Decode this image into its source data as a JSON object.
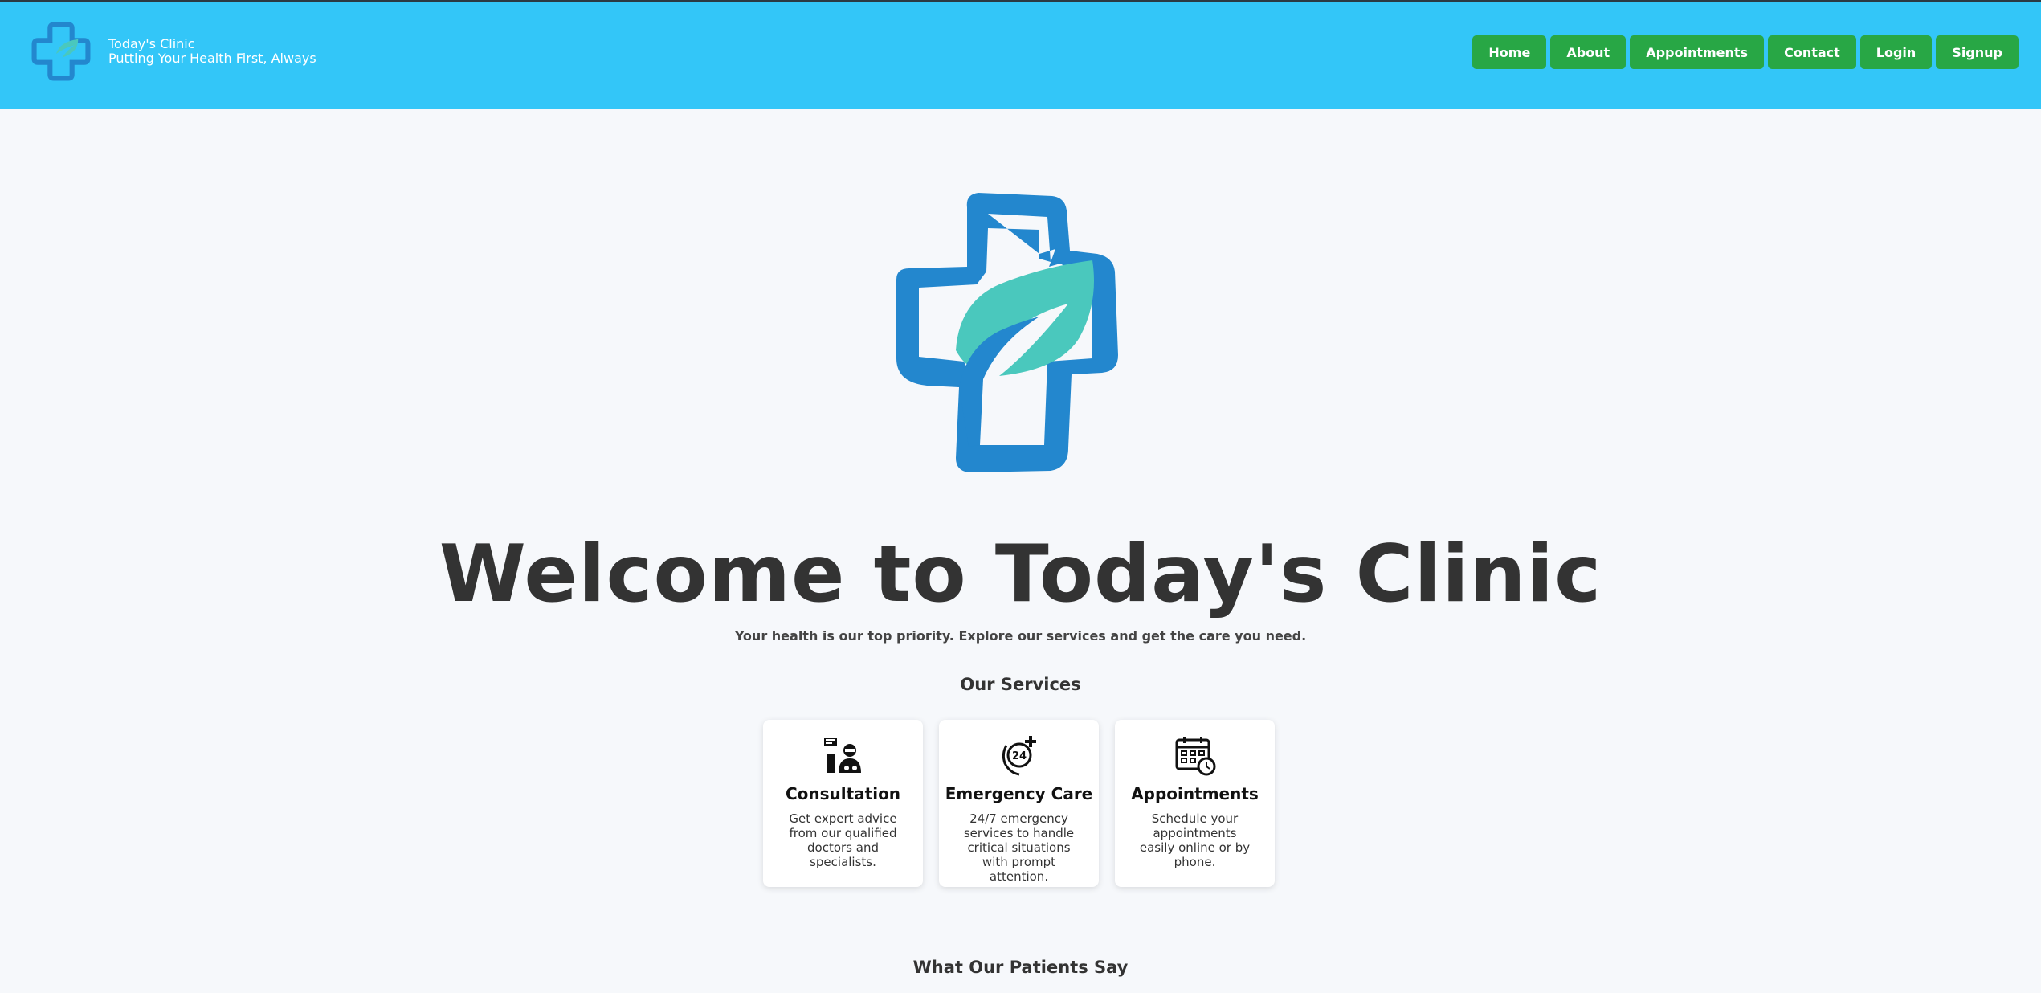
{
  "header": {
    "brand_name": "Today's Clinic",
    "tagline": "Putting Your Health First, Always",
    "logo_icon": "medical-cross-leaf-icon",
    "bg_color": "#33c6f8"
  },
  "nav": {
    "items": [
      "Home",
      "About",
      "Appointments",
      "Contact",
      "Login",
      "Signup"
    ],
    "button_color": "#28a745"
  },
  "hero": {
    "logo_icon": "medical-cross-leaf-icon",
    "title": "Welcome to Today's Clinic",
    "subtitle": "Your health is our top priority. Explore our services and get the care you need."
  },
  "services": {
    "title": "Our Services",
    "cards": [
      {
        "icon": "doctor-consultation-icon",
        "title": "Consultation",
        "description": "Get expert advice from our qualified doctors and specialists."
      },
      {
        "icon": "emergency-24-7-icon",
        "title": "Emergency Care",
        "description": "24/7 emergency services to handle critical situations with prompt attention."
      },
      {
        "icon": "calendar-clock-icon",
        "title": "Appointments",
        "description": "Schedule your appointments easily online or by phone."
      }
    ]
  },
  "testimonials": {
    "title": "What Our Patients Say"
  },
  "colors": {
    "primary_blue": "#2387ce",
    "teal": "#4ac8bd",
    "page_bg": "#f6f8fb"
  }
}
